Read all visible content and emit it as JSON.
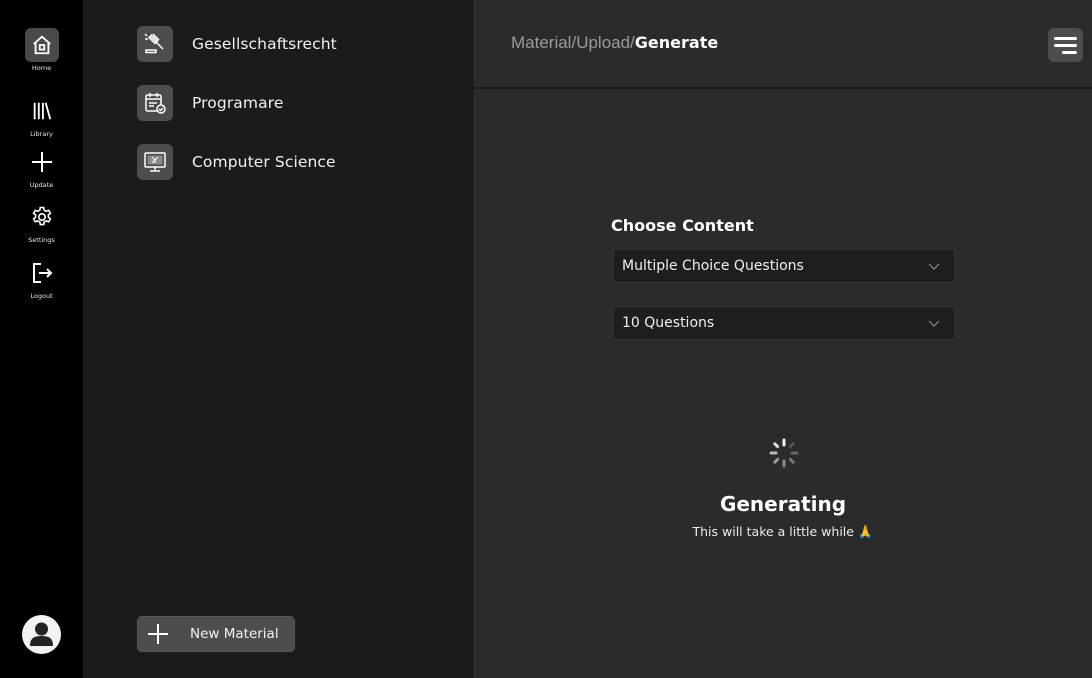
{
  "nav": {
    "items": [
      {
        "label": "Home",
        "icon": "home-icon",
        "active": true
      },
      {
        "label": "Library",
        "icon": "library-icon",
        "active": false
      },
      {
        "label": "Update",
        "icon": "plus-icon",
        "active": false
      },
      {
        "label": "Settings",
        "icon": "gear-icon",
        "active": false
      },
      {
        "label": "Logout",
        "icon": "logout-icon",
        "active": false
      }
    ],
    "avatar_icon": "user-avatar-icon"
  },
  "materials": {
    "items": [
      {
        "label": "Gesellschaftsrecht",
        "icon": "gavel-icon"
      },
      {
        "label": "Programare",
        "icon": "calendar-check-icon"
      },
      {
        "label": "Computer Science",
        "icon": "monitor-icon"
      }
    ],
    "new_button_label": "New Material"
  },
  "header": {
    "breadcrumb": [
      "Material/",
      "Upload/",
      "Generate"
    ],
    "menu_icon": "menu-icon"
  },
  "content": {
    "section_title": "Choose Content",
    "content_type_select": {
      "value": "Multiple Choice Questions"
    },
    "count_select": {
      "value": "10 Questions"
    }
  },
  "status": {
    "title": "Generating",
    "subtitle": "This will take a little while 🙏"
  }
}
